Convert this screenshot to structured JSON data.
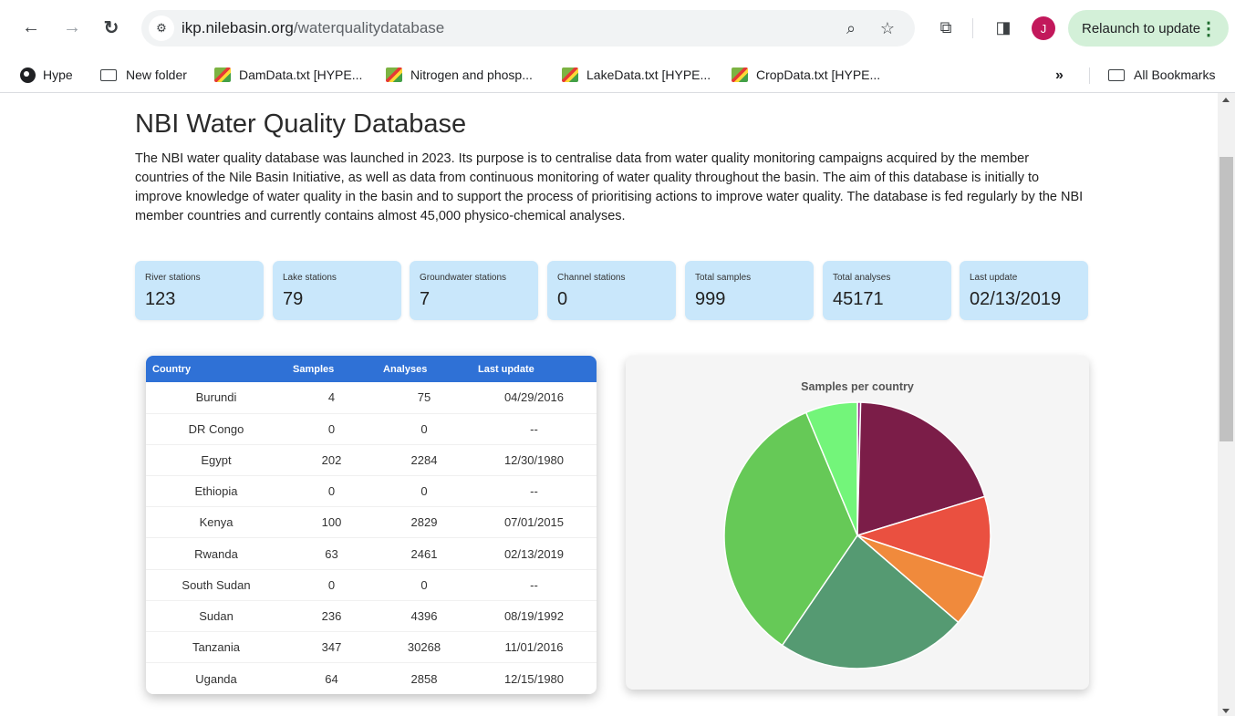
{
  "browser": {
    "url_host": "ikp.nilebasin.org",
    "url_path": "/waterqualitydatabase",
    "relaunch_label": "Relaunch to update",
    "avatar_letter": "J"
  },
  "bookmarks": {
    "items": [
      {
        "label": "Hype",
        "icon": "globe-icon"
      },
      {
        "label": "New folder",
        "icon": "folder-icon"
      },
      {
        "label": "DamData.txt [HYPE...",
        "icon": "hype-favicon"
      },
      {
        "label": "Nitrogen and phosp...",
        "icon": "hype-favicon"
      },
      {
        "label": "LakeData.txt [HYPE...",
        "icon": "hype-favicon"
      },
      {
        "label": "CropData.txt [HYPE...",
        "icon": "hype-favicon"
      }
    ],
    "overflow": "»",
    "all_bookmarks": "All Bookmarks"
  },
  "page": {
    "title": "NBI Water Quality Database",
    "intro": "The NBI water quality database was launched in 2023. Its purpose is to centralise data from water quality monitoring campaigns acquired by the member countries of the Nile Basin Initiative, as well as data from continuous monitoring of water quality throughout the basin. The aim of this database is initially to improve knowledge of water quality in the basin and to support the process of prioritising actions to improve water quality. The database is fed regularly by the NBI member countries and currently contains almost 45,000 physico-chemical analyses."
  },
  "stats": [
    {
      "label": "River stations",
      "value": "123"
    },
    {
      "label": "Lake stations",
      "value": "79"
    },
    {
      "label": "Groundwater stations",
      "value": "7"
    },
    {
      "label": "Channel stations",
      "value": "0"
    },
    {
      "label": "Total samples",
      "value": "999"
    },
    {
      "label": "Total analyses",
      "value": "45171"
    },
    {
      "label": "Last update",
      "value": "02/13/2019"
    }
  ],
  "table": {
    "headers": [
      "Country",
      "Samples",
      "Analyses",
      "Last update"
    ],
    "rows": [
      [
        "Burundi",
        "4",
        "75",
        "04/29/2016"
      ],
      [
        "DR Congo",
        "0",
        "0",
        "--"
      ],
      [
        "Egypt",
        "202",
        "2284",
        "12/30/1980"
      ],
      [
        "Ethiopia",
        "0",
        "0",
        "--"
      ],
      [
        "Kenya",
        "100",
        "2829",
        "07/01/2015"
      ],
      [
        "Rwanda",
        "63",
        "2461",
        "02/13/2019"
      ],
      [
        "South Sudan",
        "0",
        "0",
        "--"
      ],
      [
        "Sudan",
        "236",
        "4396",
        "08/19/1992"
      ],
      [
        "Tanzania",
        "347",
        "30268",
        "11/01/2016"
      ],
      [
        "Uganda",
        "64",
        "2858",
        "12/15/1980"
      ]
    ]
  },
  "chart_data": {
    "type": "pie",
    "title": "Samples per country",
    "categories": [
      "Burundi",
      "DR Congo",
      "Egypt",
      "Ethiopia",
      "Kenya",
      "Rwanda",
      "South Sudan",
      "Sudan",
      "Tanzania",
      "Uganda"
    ],
    "values": [
      4,
      0,
      202,
      0,
      100,
      63,
      0,
      236,
      347,
      64
    ],
    "colors": [
      "#9b2d8e",
      "#6a1b5e",
      "#7b1d48",
      "#c2185b",
      "#ea5040",
      "#f08a3c",
      "#e9b23b",
      "#559a72",
      "#66c957",
      "#73f57a"
    ]
  }
}
